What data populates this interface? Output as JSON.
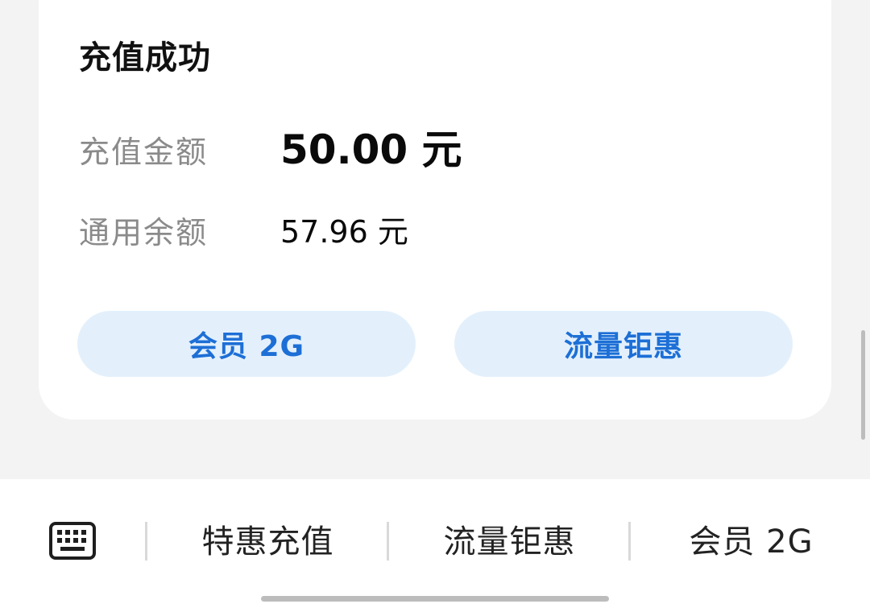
{
  "card": {
    "title": "充值成功",
    "amount_label": "充值金额",
    "amount_value": "50.00 元",
    "balance_label": "通用余额",
    "balance_value": "57.96 元",
    "buttons": [
      "会员 2G",
      "流量钜惠"
    ]
  },
  "bottom_menu": {
    "keyboard_icon": "keyboard-icon",
    "items": [
      "特惠充值",
      "流量钜惠",
      "会员 2G"
    ]
  },
  "colors": {
    "page_background": "#f3f3f3",
    "card_background": "#ffffff",
    "button_background": "#e3f0fc",
    "button_text": "#1d6fd6",
    "label_gray": "#8a8a8a"
  }
}
